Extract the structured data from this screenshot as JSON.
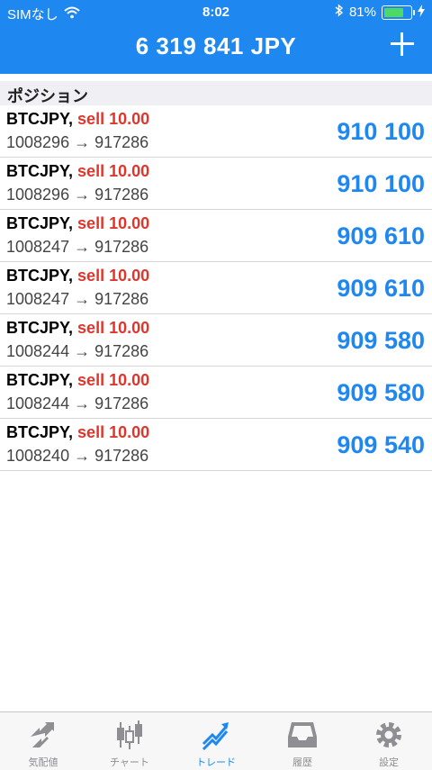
{
  "status": {
    "carrier": "SIMなし",
    "time": "8:02",
    "battery": "81%",
    "battery_level": 0.81
  },
  "header": {
    "title": "6 319 841 JPY"
  },
  "section": {
    "title": "ポジション"
  },
  "positions": [
    {
      "symbol": "BTCJPY,",
      "side": "sell 10.00",
      "prices": "1008296 → 917286",
      "profit": "910 100"
    },
    {
      "symbol": "BTCJPY,",
      "side": "sell 10.00",
      "prices": "1008296 → 917286",
      "profit": "910 100"
    },
    {
      "symbol": "BTCJPY,",
      "side": "sell 10.00",
      "prices": "1008247 → 917286",
      "profit": "909 610"
    },
    {
      "symbol": "BTCJPY,",
      "side": "sell 10.00",
      "prices": "1008247 → 917286",
      "profit": "909 610"
    },
    {
      "symbol": "BTCJPY,",
      "side": "sell 10.00",
      "prices": "1008244 → 917286",
      "profit": "909 580"
    },
    {
      "symbol": "BTCJPY,",
      "side": "sell 10.00",
      "prices": "1008244 → 917286",
      "profit": "909 580"
    },
    {
      "symbol": "BTCJPY,",
      "side": "sell 10.00",
      "prices": "1008240 → 917286",
      "profit": "909 540"
    }
  ],
  "tabs": [
    {
      "label": "気配値",
      "icon": "quotes-icon"
    },
    {
      "label": "チャート",
      "icon": "candlestick-icon"
    },
    {
      "label": "トレード",
      "icon": "trade-icon"
    },
    {
      "label": "履歴",
      "icon": "history-tray-icon"
    },
    {
      "label": "設定",
      "icon": "gear-icon"
    }
  ],
  "colors": {
    "accent": "#1e88f0",
    "sell": "#e0352b",
    "battery": "#4cd964"
  }
}
